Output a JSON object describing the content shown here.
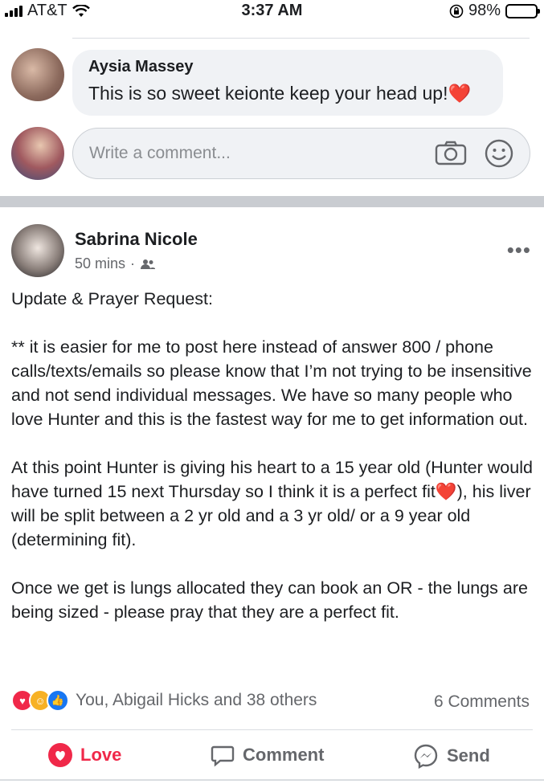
{
  "status_bar": {
    "carrier": "AT&T",
    "time": "3:37 AM",
    "battery": "98%",
    "battery_level": 0.98
  },
  "comment": {
    "author": "Aysia Massey",
    "text": "This is so sweet keionte keep your head up!",
    "emoji": "❤️"
  },
  "composer": {
    "placeholder": "Write a comment..."
  },
  "post": {
    "author": "Sabrina Nicole",
    "time": "50 mins",
    "dot": "·",
    "paragraphs": {
      "p1": "Update & Prayer Request:",
      "p2": "** it is easier for me to post here instead of answer 800 / phone calls/texts/emails so please know that I’m not trying to be insensitive and not send individual messages.  We have so many people who love Hunter and this is the fastest way for me to get information out.",
      "p3a": "At this point Hunter is giving his heart to a 15 year old (Hunter would have turned 15 next Thursday so I think it is a perfect fit",
      "p3_emoji": "❤️",
      "p3b": "), his liver will be split between a 2 yr old and a 3 yr old/ or a 9 year old (determining fit).",
      "p4": "Once we get is lungs allocated they can book an OR - the lungs are being sized - please pray that they are a perfect fit."
    },
    "reactions_text": "You, Abigail Hicks and 38 others",
    "comments_count": "6 Comments"
  },
  "actions": {
    "love": "Love",
    "comment": "Comment",
    "send": "Send"
  },
  "colors": {
    "love": "#f02849",
    "like": "#1877f2",
    "care": "#f7b125",
    "separator": "#c9ccd1"
  }
}
